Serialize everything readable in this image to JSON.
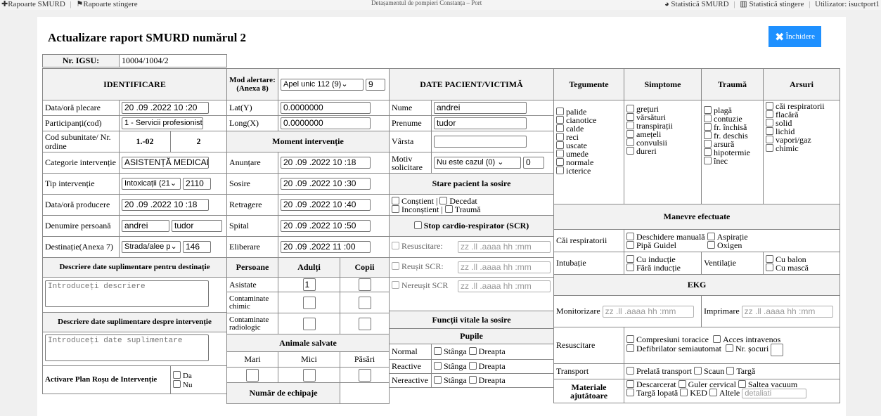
{
  "topbar": {
    "rap_smurd": "Rapoarte SMURD",
    "rap_stingere": "Rapoarte stingere",
    "detasament": "Detașamentul de pompieri Constanța – Port",
    "stat_smurd": "Statistică SMURD",
    "stat_stingere": "Statistică stingere",
    "utilizator": "Utilizator: isuctport1"
  },
  "header": {
    "title": "Actualizare raport SMURD numărul 2",
    "close": "Închidere"
  },
  "igsu": {
    "label": "Nr. IGSU:",
    "value": "10004/1004/2"
  },
  "identificare": {
    "title": "IDENTIFICARE",
    "data_plecare_label": "Data/oră plecare",
    "data_plecare": "20 .09 .2022  10 :20",
    "participanti_label": "Participanți(cod)",
    "participanti": "1 - Servicii profesionist",
    "cod_label": "Cod subunitate/ Nr. ordine",
    "cod": "1.-02",
    "nr_ordine": "2",
    "categorie_label": "Categorie intervenție",
    "categorie": "ASISTENȚĂ MEDICAL",
    "tip_label": "Tip intervenție",
    "tip": "Intoxicații (21",
    "tip_code": "2110",
    "data_producere_label": "Data/oră producere",
    "data_producere": "20 .09 .2022  10 :18",
    "denumire_label": "Denumire persoană",
    "nume": "andrei",
    "prenume": "tudor",
    "destinatie_label": "Destinație(Anexa 7)",
    "destinatie": "Strada/alee p",
    "destinatie_nr": "146"
  },
  "desc_dest": {
    "title": "Descriere date suplimentare pentru destinație",
    "placeholder": "Introduceți descriere"
  },
  "desc_int": {
    "title": "Descriere date suplimentare despre intervenție",
    "placeholder": "Introduceți date suplimentare"
  },
  "plan_rosu": {
    "label": "Activare Plan Roșu de Intervenție",
    "da": "Da",
    "nu": "Nu"
  },
  "mod": {
    "label": "Mod alertare: (Anexa 8)",
    "value": "Apel unic 112 (9)",
    "code": "9"
  },
  "coord": {
    "lat_label": "Lat(Y)",
    "lat": "0.0000000",
    "long_label": "Long(X)",
    "long": "0.0000000"
  },
  "moment": {
    "title": "Moment intervenție",
    "rows": [
      {
        "label": "Anunțare",
        "value": "20 .09 .2022  10 :18"
      },
      {
        "label": "Sosire",
        "value": "20 .09 .2022  10 :30"
      },
      {
        "label": "Retragere",
        "value": "20 .09 .2022  10 :40"
      },
      {
        "label": "Spital",
        "value": "20 .09 .2022  10 :50"
      },
      {
        "label": "Eliberare",
        "value": "20 .09 .2022  11 :00"
      }
    ]
  },
  "persoane": {
    "title": "Persoane",
    "adulti": "Adulți",
    "copii": "Copii",
    "asistate": "Asistate",
    "asistate_adulti": "1",
    "contaminate_chimic": "Contaminate chimic",
    "contaminate_radiologic": "Contaminate radiologic"
  },
  "animale": {
    "title": "Animale salvate",
    "mari": "Mari",
    "mici": "Mici",
    "pasari": "Păsări"
  },
  "echipaje": {
    "title": "Număr de echipaje"
  },
  "pacient": {
    "title": "DATE PACIENT/VICTIMĂ",
    "nume_label": "Nume",
    "nume": "andrei",
    "prenume_label": "Prenume",
    "prenume": "tudor",
    "varsta_label": "Vârsta",
    "motiv_label": "Motiv solicitare",
    "motiv": "Nu este cazul (0)",
    "motiv_code": "0"
  },
  "stare": {
    "title": "Stare pacient la sosire",
    "constient": "Conștient",
    "decedat": "Decedat",
    "inconstient": "Inconștient",
    "trauma": "Traumă"
  },
  "scr": {
    "title": "Stop cardio-respirator (SCR)",
    "resuscitare": "Resuscitare:",
    "reusit": "Reușit SCR:",
    "nereusit": "Nereușit SCR",
    "dt_placeholder": "zz .ll  .aaaa  hh :mm"
  },
  "vitale": {
    "title": "Funcții vitale la sosire",
    "pupile": "Pupile",
    "stanga": "Stânga",
    "dreapta": "Dreapta",
    "rows": [
      "Normal",
      "Reactive",
      "Nereactive"
    ]
  },
  "tegumente": {
    "title": "Tegumente",
    "items": [
      "palide",
      "cianotice",
      "calde",
      "reci",
      "uscate",
      "umede",
      "normale",
      "icterice"
    ]
  },
  "simptome": {
    "title": "Simptome",
    "items": [
      "grețuri",
      "vărsături",
      "transpirații",
      "amețeli",
      "convulsii",
      "dureri"
    ]
  },
  "trauma": {
    "title": "Traumă",
    "items": [
      "plagă",
      "contuzie",
      "fr. închisă",
      "fr. deschis",
      "arsură",
      "hipotermie",
      "înec"
    ]
  },
  "arsuri": {
    "title": "Arsuri",
    "items": [
      "căi respiratorii",
      "flacără",
      "solid",
      "lichid",
      "vapori/gaz",
      "chimic"
    ]
  },
  "manevre": {
    "title": "Manevre efectuate",
    "cai_label": "Căi respiratorii",
    "deschidere": "Deschidere manuală",
    "aspiratie": "Aspirație",
    "pipa": "Pipă Guidel",
    "oxigen": "Oxigen",
    "intubatie_label": "Intubație",
    "cu_inductie": "Cu inducție",
    "fara_inductie": "Fără inducție",
    "ventilatie_label": "Ventilație",
    "cu_balon": "Cu balon",
    "cu_masca": "Cu mască"
  },
  "ekg": {
    "title": "EKG",
    "monitorizare": "Monitorizare",
    "imprimare": "Imprimare"
  },
  "resusc": {
    "label": "Resuscitare",
    "compresiuni": "Compresiuni toracice",
    "acces": "Acces intravenos",
    "defibrilator": "Defibrilator semiautomat",
    "socuri": "Nr. șocuri"
  },
  "transport": {
    "label": "Transport",
    "prelata": "Prelată transport",
    "scaun": "Scaun",
    "targa": "Targă"
  },
  "materiale": {
    "label": "Materiale ajutătoare",
    "descarcerat": "Descarcerat",
    "guler": "Guler cervical",
    "saltea": "Saltea vacuum",
    "targa_lopata": "Targă lopată",
    "ked": "KED",
    "altele": "Altele",
    "detalii_placeholder": "detaliati"
  }
}
